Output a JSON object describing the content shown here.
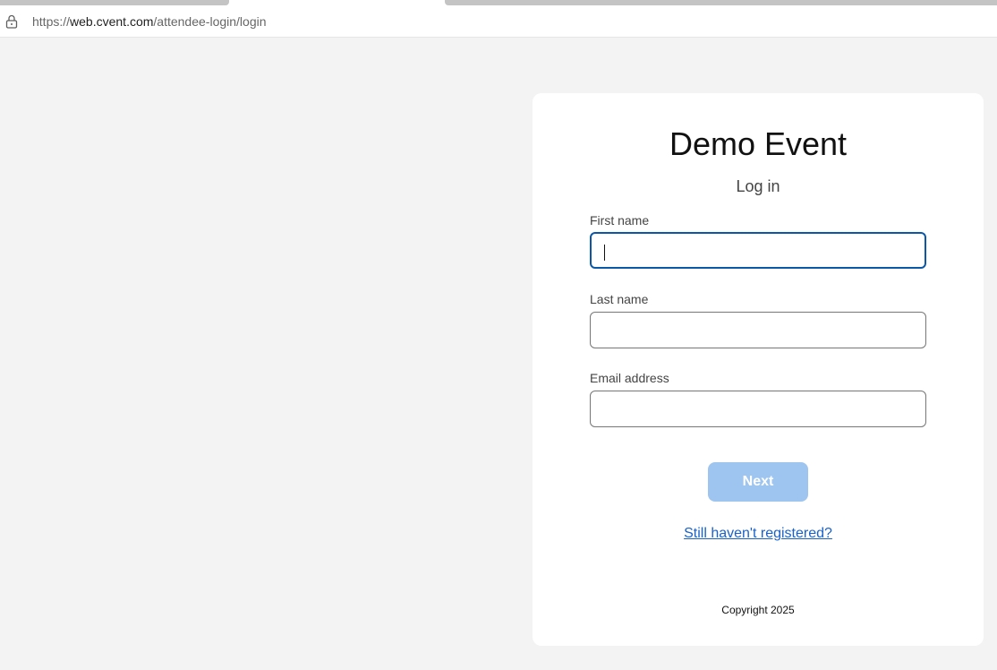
{
  "browser": {
    "url_scheme": "https://",
    "url_host": "web.cvent.com",
    "url_path": "/attendee-login/login",
    "lock_icon": "lock-icon"
  },
  "login": {
    "event_title": "Demo Event",
    "subtitle": "Log in",
    "fields": [
      {
        "label": "First name",
        "value": "",
        "focused": true
      },
      {
        "label": "Last name",
        "value": ""
      },
      {
        "label": "Email address",
        "value": ""
      }
    ],
    "next_label": "Next",
    "register_link": "Still haven't registered?",
    "copyright": "Copyright 2025"
  },
  "colors": {
    "page_background": "#f3f3f3",
    "focus_border": "#0b57a8",
    "button_disabled": "#9ec5f0",
    "link": "#1a62c9"
  }
}
